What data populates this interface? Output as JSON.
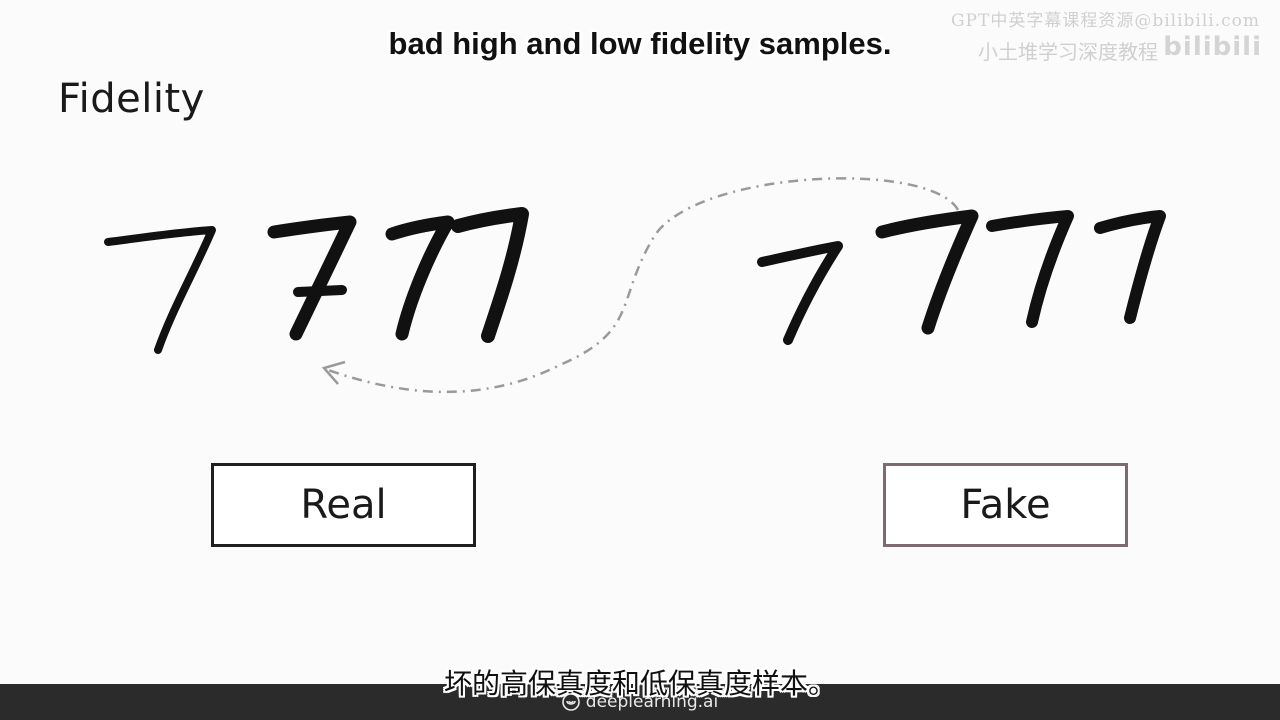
{
  "slide": {
    "title": "Fidelity",
    "subtitle_top": "bad high and low fidelity samples.",
    "subtitle_bottom": "坏的高保真度和低保真度样本。",
    "labels": {
      "real": "Real",
      "fake": "Fake"
    }
  },
  "watermark": {
    "line1": "GPT中英字幕课程资源@bilibili.com",
    "line2": "小土堆学习深度教程",
    "logo": "bilibili"
  },
  "footer": {
    "brand": "deeplearning.ai",
    "icon": "deeplearning-logo-icon"
  },
  "colors": {
    "background": "#fbfbfb",
    "ink": "#111111",
    "fake_border": "#7d6b6f",
    "arrow": "#9a9a9a",
    "footer_bg": "#2b2b2b"
  }
}
